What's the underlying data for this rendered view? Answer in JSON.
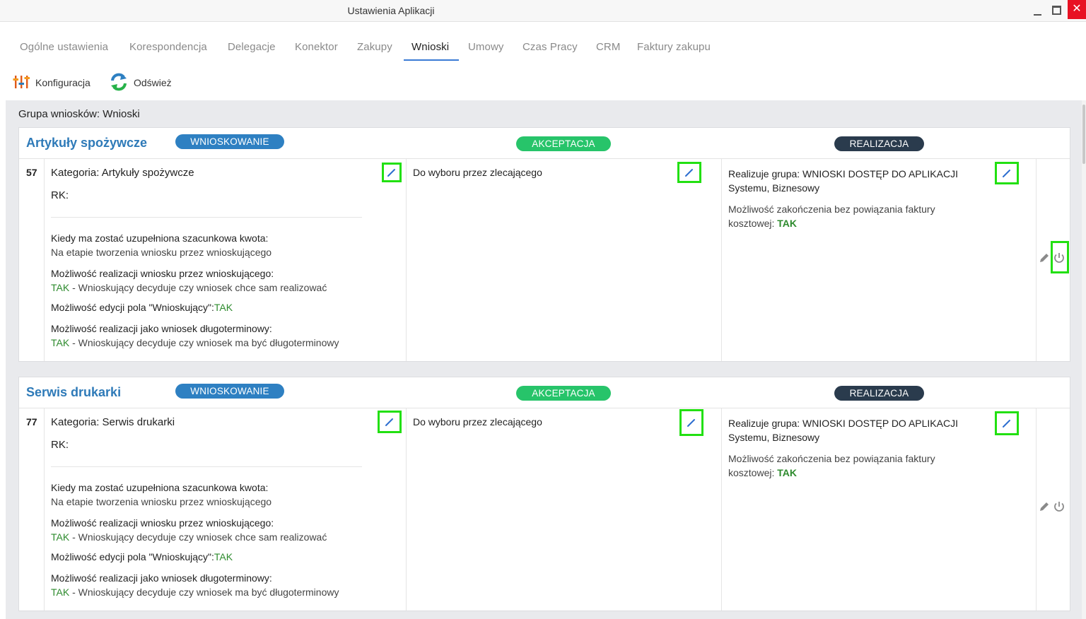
{
  "window": {
    "title": "Ustawienia Aplikacji",
    "close_glyph": "✕"
  },
  "tabs": [
    {
      "label": "Ogólne ustawienia"
    },
    {
      "label": "Korespondencja"
    },
    {
      "label": "Delegacje"
    },
    {
      "label": "Konektor"
    },
    {
      "label": "Zakupy"
    },
    {
      "label": "Wnioski",
      "active": true
    },
    {
      "label": "Umowy"
    },
    {
      "label": "Czas Pracy"
    },
    {
      "label": "CRM"
    },
    {
      "label": "Faktury zakupu"
    }
  ],
  "toolbar": {
    "config_label": "Konfiguracja",
    "refresh_label": "Odśwież"
  },
  "group_title": "Grupa wniosków: Wnioski",
  "stage_labels": {
    "wnioskowanie": "WNIOSKOWANIE",
    "akceptacja": "AKCEPTACJA",
    "realizacja": "REALIZACJA"
  },
  "requests": [
    {
      "title": "Artykuły spożywcze",
      "number": "57",
      "category": "Kategoria: Artykuły spożywcze",
      "rk": "RK:",
      "q1": "Kiedy ma zostać uzupełniona szacunkowa kwota:",
      "a1": "Na etapie tworzenia wniosku przez wnioskującego",
      "q2": "Możliwość realizacji wniosku przez wnioskującego:",
      "a2_flag": "TAK",
      "a2_text": " - Wnioskujący decyduje czy wniosek chce sam realizować",
      "q3": "Możliwość edycji pola \"Wnioskujący\":",
      "q3_flag": "TAK",
      "q4": "Możliwość realizacji jako wniosek długoterminowy:",
      "a4_flag": "TAK",
      "a4_text": " - Wnioskujący decyduje czy wniosek ma być długoterminowy",
      "acceptance": "Do wyboru przez zlecającego",
      "realization_group": "Realizuje grupa: WNIOSKI DOSTĘP DO APLIKACJI",
      "realization_members": "Systemu, Biznesowy",
      "closing_text": "Możliwość zakończenia bez powiązania faktury kosztowej: ",
      "closing_flag": "TAK"
    },
    {
      "title": "Serwis drukarki",
      "number": "77",
      "category": "Kategoria: Serwis drukarki",
      "rk": "RK:",
      "q1": "Kiedy ma zostać uzupełniona szacunkowa kwota:",
      "a1": "Na etapie tworzenia wniosku przez wnioskującego",
      "q2": "Możliwość realizacji wniosku przez wnioskującego:",
      "a2_flag": "TAK",
      "a2_text": " - Wnioskujący decyduje czy wniosek chce sam realizować",
      "q3": "Możliwość edycji pola \"Wnioskujący\":",
      "q3_flag": "TAK",
      "q4": "Możliwość realizacji jako wniosek długoterminowy:",
      "a4_flag": "TAK",
      "a4_text": " - Wnioskujący decyduje czy wniosek ma być długoterminowy",
      "acceptance": "Do wyboru przez zlecającego",
      "realization_group": "Realizuje grupa: WNIOSKI DOSTĘP DO APLIKACJI",
      "realization_members": "Systemu, Biznesowy",
      "closing_text": "Możliwość zakończenia bez powiązania faktury kosztowej: ",
      "closing_flag": "TAK"
    }
  ],
  "colors": {
    "accent": "#3a7bd5",
    "title_blue": "#2e7ab8",
    "highlight": "#22e011",
    "yes_green": "#2e8b2e"
  },
  "icons": {
    "config": "sliders-icon",
    "refresh": "refresh-icon",
    "edit": "pencil-icon",
    "power": "power-icon"
  }
}
